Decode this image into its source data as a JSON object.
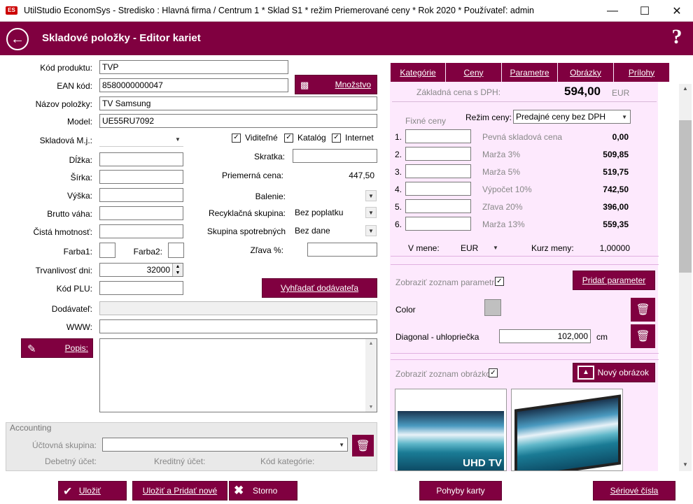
{
  "window": {
    "title": "UtilStudio EconomSys - Stredisko : Hlavná firma /  Centrum 1 * Sklad S1 * režim Priemerované ceny * Rok 2020 * Používateľ: admin",
    "app_icon": "ES",
    "minimize": "—",
    "maximize": "☐",
    "close": "✕"
  },
  "header": {
    "title": "Skladové položky - Editor kariet",
    "help": "?"
  },
  "form": {
    "kod_produktu": {
      "label": "Kód produktu:",
      "value": "TVP"
    },
    "ean": {
      "label": "EAN kód:",
      "value": "8580000000047"
    },
    "mnozstvo_btn": "Množstvo",
    "nazov": {
      "label": "Názov položky:",
      "value": "TV Samsung"
    },
    "model": {
      "label": "Model:",
      "value": "UE55RU7092"
    },
    "skladova_mj": {
      "label": "Skladová M.j.:",
      "value": ""
    },
    "viditelne": "Viditeľné",
    "katalog": "Katalóg",
    "internet": "Internet",
    "dlzka": "Dĺžka:",
    "sirka": "Šírka:",
    "vyska": "Výška:",
    "brutto": "Brutto váha:",
    "cista": "Čistá hmotnosť:",
    "farba1": "Farba1:",
    "farba2": "Farba2:",
    "skratka": "Skratka:",
    "priemerna": {
      "label": "Priemerná cena:",
      "value": "447,50"
    },
    "balenie": "Balenie:",
    "recyklacna": {
      "label": "Recyklačná skupina:",
      "value": "Bez poplatku"
    },
    "spotrebna": {
      "label": "Skupina spotrebných",
      "value": "Bez dane"
    },
    "zlava": "Zľava %:",
    "trvanlivost": {
      "label": "Trvanlivosť dni:",
      "value": "32000"
    },
    "kod_plu": "Kód PLU:",
    "vyhladat_btn": "Vyhľadať dodávateľa",
    "dodavatel": "Dodávateľ:",
    "www": "WWW:",
    "popis_btn": "Popis:"
  },
  "accounting": {
    "legend": "Accounting",
    "uctovna": "Účtovná skupina:",
    "debetny": "Debetný účet:",
    "kreditny": "Kreditný účet:",
    "kod_kat": "Kód kategórie:"
  },
  "tabs": [
    "Kategórie",
    "Ceny",
    "Parametre",
    "Obrázky",
    "Prílohy"
  ],
  "prices": {
    "zakladna_label": "Základná cena s DPH:",
    "zakladna_value": "594,00",
    "currency": "EUR",
    "fixne": "Fixné ceny",
    "rezim_label": "Režim ceny:",
    "rezim_value": "Predajné ceny bez DPH",
    "rows": [
      {
        "n": "1.",
        "name": "Pevná skladová cena",
        "value": "0,00"
      },
      {
        "n": "2.",
        "name": "Marža 3%",
        "value": "509,85"
      },
      {
        "n": "3.",
        "name": "Marža 5%",
        "value": "519,75"
      },
      {
        "n": "4.",
        "name": "Výpočet 10%",
        "value": "742,50"
      },
      {
        "n": "5.",
        "name": "Zľava 20%",
        "value": "396,00"
      },
      {
        "n": "6.",
        "name": "Marža 13%",
        "value": "559,35"
      }
    ],
    "v_mene": "V mene:",
    "mena": "EUR",
    "kurz_label": "Kurz meny:",
    "kurz_value": "1,00000"
  },
  "params": {
    "zobrazit": "Zobraziť zoznam parametrov",
    "pridat": "Pridať parameter",
    "color": "Color",
    "diagonal": "Diagonal - uhlopriečka",
    "diagonal_value": "102,000",
    "unit": "cm",
    "swatch": "#c0c0c0"
  },
  "images": {
    "zobrazit": "Zobraziť zoznam obrázkov",
    "novy": "Nový obrázok",
    "uhd": "UHD TV"
  },
  "bottom": {
    "ulozit": "Uložiť",
    "ulozit_pridat": "Uložiť a Pridať nové",
    "storno": "Storno",
    "pohyby": "Pohyby karty",
    "seriove": "Sériové čísla"
  },
  "colors": {
    "accent": "#800040",
    "panel": "#fde9fd"
  }
}
